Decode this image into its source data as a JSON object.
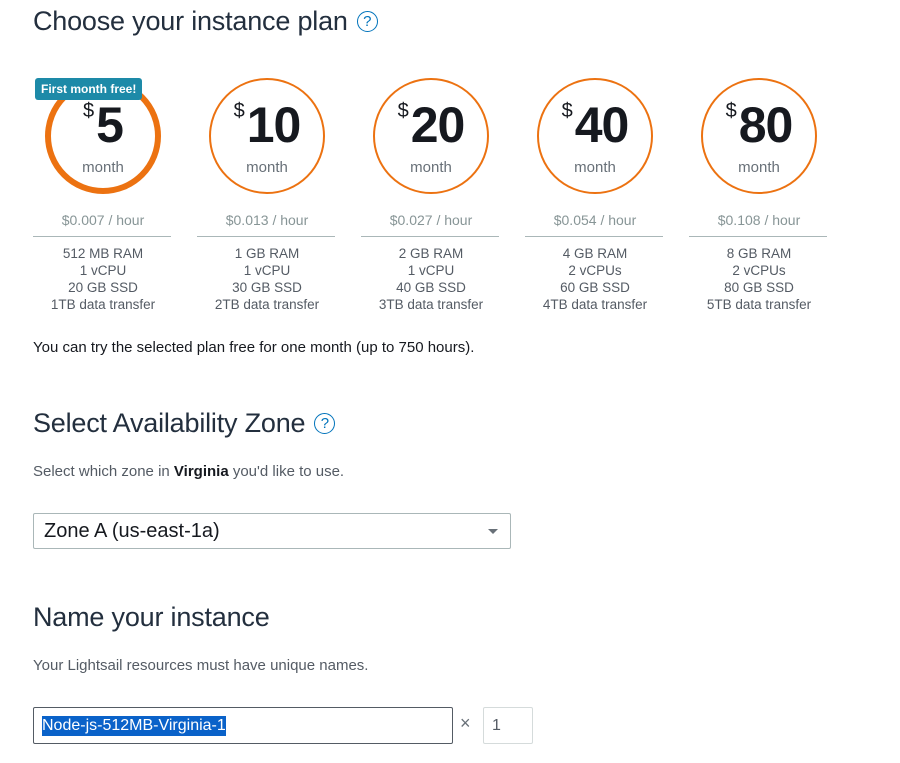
{
  "plan_section": {
    "title": "Choose your instance plan",
    "badge": "First month free!",
    "currency_symbol": "$",
    "period": "month",
    "plans": [
      {
        "price": "5",
        "hourly": "$0.007 / hour",
        "ram": "512 MB RAM",
        "cpu": "1 vCPU",
        "ssd": "20 GB SSD",
        "transfer": "1TB data transfer",
        "selected": true
      },
      {
        "price": "10",
        "hourly": "$0.013 / hour",
        "ram": "1 GB RAM",
        "cpu": "1 vCPU",
        "ssd": "30 GB SSD",
        "transfer": "2TB data transfer",
        "selected": false
      },
      {
        "price": "20",
        "hourly": "$0.027 / hour",
        "ram": "2 GB RAM",
        "cpu": "1 vCPU",
        "ssd": "40 GB SSD",
        "transfer": "3TB data transfer",
        "selected": false
      },
      {
        "price": "40",
        "hourly": "$0.054 / hour",
        "ram": "4 GB RAM",
        "cpu": "2 vCPUs",
        "ssd": "60 GB SSD",
        "transfer": "4TB data transfer",
        "selected": false
      },
      {
        "price": "80",
        "hourly": "$0.108 / hour",
        "ram": "8 GB RAM",
        "cpu": "2 vCPUs",
        "ssd": "80 GB SSD",
        "transfer": "5TB data transfer",
        "selected": false
      }
    ],
    "free_note": "You can try the selected plan free for one month (up to 750 hours)."
  },
  "zone_section": {
    "title": "Select Availability Zone",
    "desc_prefix": "Select which zone in ",
    "region": "Virginia",
    "desc_suffix": " you'd like to use.",
    "selected_zone": "Zone A (us-east-1a)"
  },
  "name_section": {
    "title": "Name your instance",
    "desc": "Your Lightsail resources must have unique names.",
    "instance_name": "Node-js-512MB-Virginia-1",
    "multiply_symbol": "×",
    "count": "1"
  },
  "colors": {
    "accent_orange": "#ec7211",
    "badge_teal": "#1d8aa8",
    "link_blue": "#0073bb",
    "selection_blue": "#0a62c9"
  },
  "icons": [
    "help-icon",
    "chevron-down-icon"
  ]
}
